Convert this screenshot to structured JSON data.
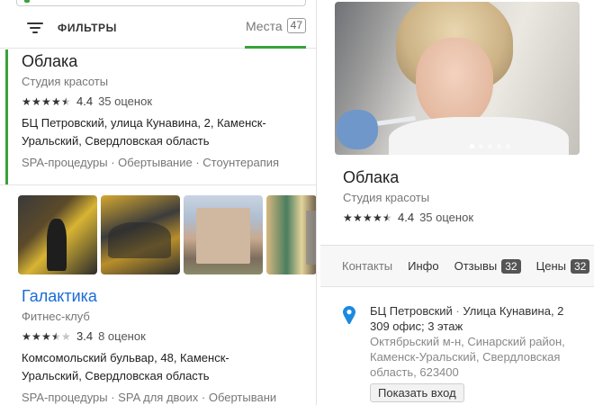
{
  "filters": {
    "label": "ФИЛЬТРЫ",
    "places_label": "Места",
    "places_count": "47"
  },
  "results": [
    {
      "name": "Облака",
      "category": "Студия красоты",
      "rating": "4.4",
      "rating_value": 4.4,
      "reviews": "35 оценок",
      "address_line1": "БЦ Петровский, улица Кунавина, 2, Каменск-",
      "address_line2": "Уральский, Свердловская область",
      "tags": "SPA-процедуры · Обертывание · Стоунтерапия"
    },
    {
      "name": "Галактика",
      "category": "Фитнес-клуб",
      "rating": "3.4",
      "rating_value": 3.4,
      "reviews": "8 оценок",
      "address_line1": "Комсомольский бульвар, 48, Каменск-",
      "address_line2": "Уральский, Свердловская область",
      "tags": "SPA-процедуры · SPA для двоих · Обертывани"
    }
  ],
  "detail": {
    "name": "Облака",
    "category": "Студия красоты",
    "rating": "4.4",
    "rating_value": 4.4,
    "reviews": "35 оценок",
    "photo_count": 5,
    "active_photo": 1,
    "tabs": [
      {
        "label": "Контакты",
        "badge": ""
      },
      {
        "label": "Инфо",
        "badge": ""
      },
      {
        "label": "Отзывы",
        "badge": "32"
      },
      {
        "label": "Цены",
        "badge": "32"
      }
    ],
    "address_main": "БЦ Петровский",
    "address_street": "Улица Кунавина, 2",
    "address_office": "309 офис; 3 этаж",
    "address_district": "Октябрьский м-н, Синарский район,",
    "address_region": "Каменск-Уральский, Свердловская",
    "address_postal": "область, 623400",
    "show_entrance_label": "Показать вход"
  },
  "colors": {
    "accent_green": "#3aa23a",
    "link_blue": "#1a6bd6",
    "pin_blue": "#1a8ae0"
  },
  "icons": {
    "filter": "filter-icon",
    "star": "star-icon",
    "pin": "location-pin-icon"
  }
}
